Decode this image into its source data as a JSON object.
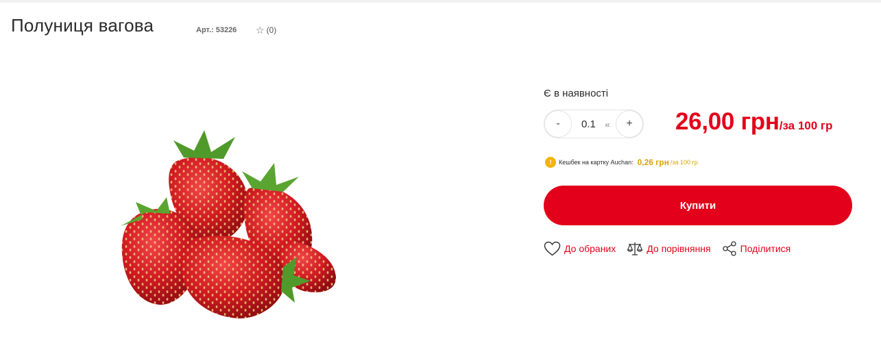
{
  "product": {
    "title": "Полуниця вагова",
    "article": "Арт.: 53226",
    "reviews": "(0)"
  },
  "availability": "Є в наявності",
  "quantity": {
    "value": "0.1",
    "unit": "кг.",
    "minus": "-",
    "plus": "+"
  },
  "price": {
    "amount": "26,00 грн",
    "per": "/за 100 гр"
  },
  "cashback": {
    "label": "Кешбек на картку Auchan:",
    "value": "0,26 грн",
    "per": "/за 100 гр"
  },
  "buy_label": "Купити",
  "actions": {
    "favorites": "До обраних",
    "compare": "До порівняння",
    "share": "Поділитися"
  },
  "colors": {
    "accent": "#e2001a",
    "cashback": "#d9a400"
  },
  "icons": [
    "star-icon",
    "coin-icon",
    "heart-icon",
    "scales-icon",
    "share-icon"
  ]
}
